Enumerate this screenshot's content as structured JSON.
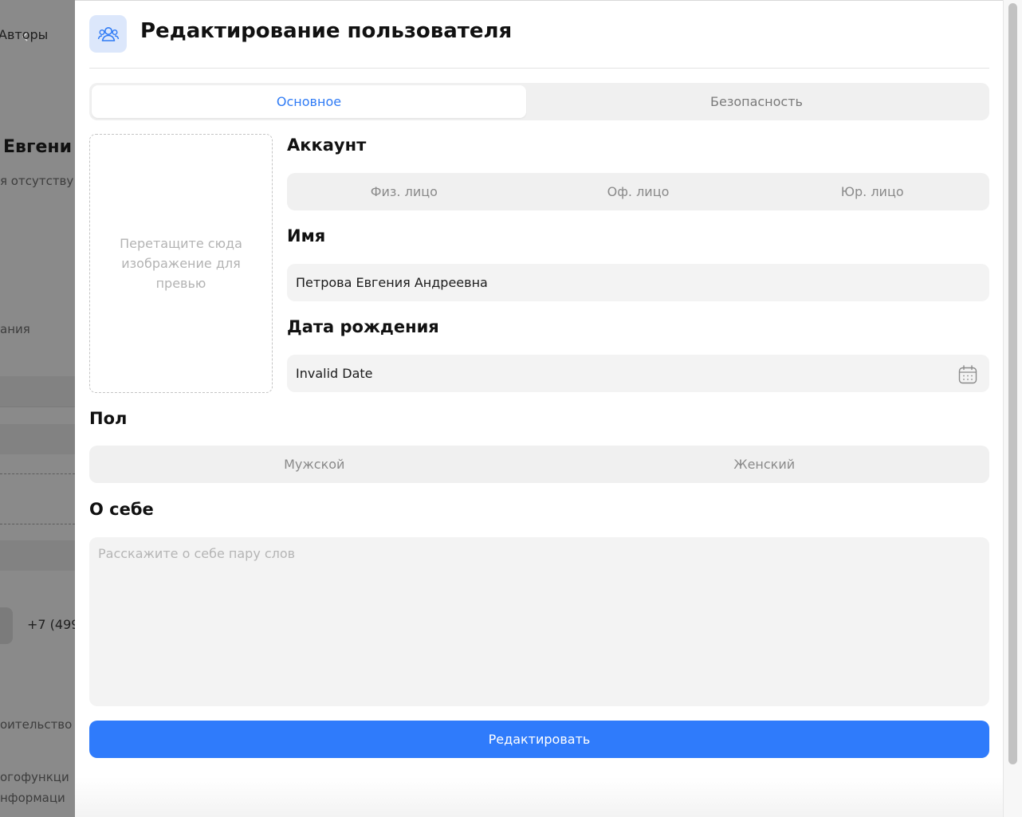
{
  "background": {
    "breadcrumb": "Авторы",
    "name_fragment": "Евгени",
    "status_fragment": "я отсутству",
    "section_fragment": "ания",
    "phone_fragment": "+7 (499",
    "line1_fragment": "оительство",
    "line2_fragment": "огофункци",
    "line3_fragment": "нформаци"
  },
  "modal": {
    "title": "Редактирование пользователя",
    "tabs": [
      {
        "label": "Основное",
        "active": true
      },
      {
        "label": "Безопасность",
        "active": false
      }
    ],
    "dropzone_text": "Перетащите сюда изображение для превью",
    "account": {
      "label": "Аккаунт",
      "options": [
        "Физ. лицо",
        "Оф. лицо",
        "Юр. лицо"
      ]
    },
    "name": {
      "label": "Имя",
      "value": "Петрова Евгения Андреевна"
    },
    "birthdate": {
      "label": "Дата рождения",
      "value": "Invalid Date",
      "icon": "calendar-icon"
    },
    "gender": {
      "label": "Пол",
      "options": [
        "Мужской",
        "Женский"
      ]
    },
    "about": {
      "label": "О себе",
      "placeholder": "Расскажите о себе пару слов"
    },
    "submit_label": "Редактировать"
  },
  "colors": {
    "accent": "#2f7bfb",
    "tab_active_text": "#2f7bf5",
    "field_bg": "#f3f3f3",
    "icon_bg": "#dce7fb"
  }
}
